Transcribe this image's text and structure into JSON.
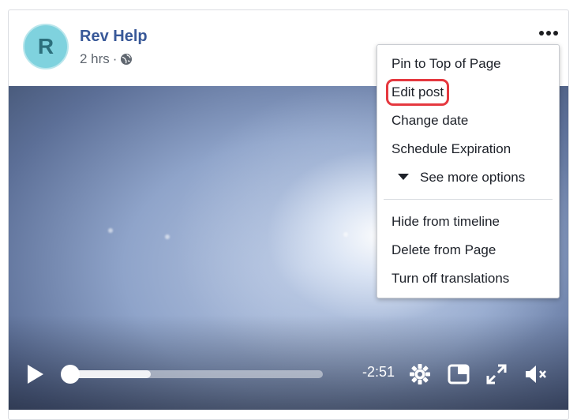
{
  "post": {
    "avatar_letter": "R",
    "page_name": "Rev Help",
    "time": "2 hrs",
    "separator": "·",
    "globe_icon": "globe-icon"
  },
  "video": {
    "remaining_time": "-2:51",
    "progress": 0.32,
    "controls": [
      "play-icon",
      "gear-icon",
      "pip-icon",
      "expand-icon",
      "mute-icon"
    ]
  },
  "menu": {
    "items": [
      "Pin to Top of Page",
      "Edit post",
      "Change date",
      "Schedule Expiration",
      "See more options",
      "Hide from timeline",
      "Delete from Page",
      "Turn off translations"
    ],
    "highlighted_item": "Edit post",
    "highlight_color": "#e5383f"
  },
  "colors": {
    "link": "#385898",
    "avatar": "#7fd2de"
  }
}
